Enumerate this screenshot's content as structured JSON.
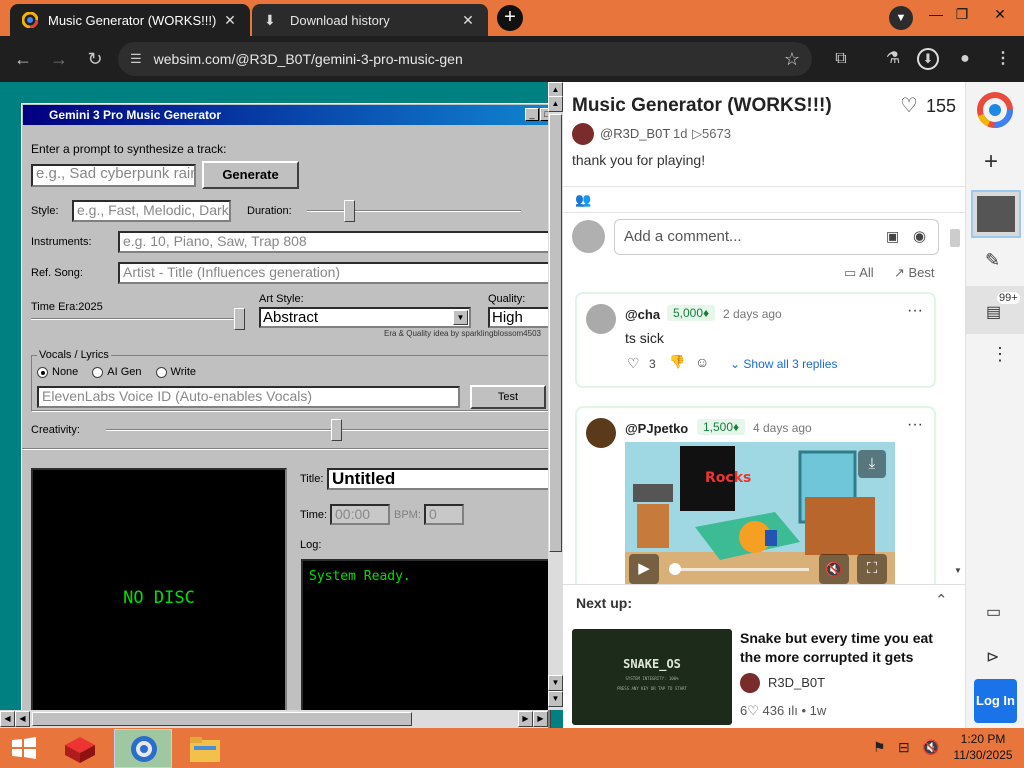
{
  "browser": {
    "tabs": [
      {
        "label": "Music Generator (WORKS!!!)",
        "active": true,
        "close": "✕"
      },
      {
        "label": "Download history",
        "active": false,
        "close": "✕"
      }
    ],
    "new_tab": "+",
    "url": "websim.com/@R3D_B0T/gemini-3-pro-music-gen",
    "window_controls": {
      "minimize": "—",
      "maximize": "❐",
      "close": "✕"
    },
    "colors": {
      "tabbar": "#e8763c",
      "toolbar": "#1f1f1f"
    }
  },
  "app": {
    "title": "Gemini 3 Pro Music Generator",
    "prompt_label": "Enter a prompt to synthesize a track:",
    "prompt_placeholder": "e.g., Sad cyberpunk rain",
    "generate_label": "Generate",
    "style_label": "Style:",
    "style_placeholder": "e.g., Fast, Melodic, Dark",
    "duration_label": "Duration:",
    "duration_level": 0.18,
    "instruments_label": "Instruments:",
    "instruments_placeholder": "e.g. 10, Piano, Saw, Trap 808",
    "refsong_label": "Ref. Song:",
    "refsong_placeholder": "Artist - Title (Influences generation)",
    "time_era_label": "Time Era:2025",
    "time_era_level": 1.0,
    "art_style_label": "Art Style:",
    "art_style_value": "Abstract",
    "quality_label": "Quality:",
    "quality_value": "High",
    "credit": "Era & Quality idea by sparklingblossom4503",
    "vocals_group": "Vocals / Lyrics",
    "vocal_options": [
      {
        "label": "None",
        "selected": true
      },
      {
        "label": "AI Gen",
        "selected": false
      },
      {
        "label": "Write",
        "selected": false
      }
    ],
    "voice_placeholder": "ElevenLabs Voice ID (Auto-enables Vocals)",
    "test_label": "Test",
    "creativity_label": "Creativity:",
    "creativity_level": 0.52,
    "disc_text": "NO DISC",
    "title_label": "Title:",
    "title_value": "Untitled",
    "time_label": "Time:",
    "time_value": "00:00",
    "bpm_label": "BPM:",
    "bpm_value": "0",
    "log_label": "Log:",
    "log_text": "System Ready."
  },
  "panel": {
    "title": "Music Generator (WORKS!!!)",
    "likes": "155",
    "author": "@R3D_B0T",
    "age": "1d",
    "views": "▷5673",
    "description": "thank you for playing!",
    "comment_placeholder": "Add a comment...",
    "filter_all": "All",
    "filter_best": "Best",
    "comments": [
      {
        "user": "@cha",
        "badge": "5,000♦",
        "time": "2 days ago",
        "text": "ts sick",
        "likes": "3",
        "replies": "Show all 3 replies"
      },
      {
        "user": "@PJpetko",
        "badge": "1,500♦",
        "time": "4 days ago",
        "media_sign": "Rocks"
      }
    ],
    "next_up_label": "Next up:",
    "next_title": "Snake but every time you eat the more corrupted it gets",
    "next_thumb_title": "SNAKE_OS",
    "next_thumb_sub1": "SYSTEM INTEGRITY: 100%",
    "next_thumb_sub2": "PRESS ANY KEY OR TAP TO START",
    "next_author": "R3D_B0T",
    "next_stats": "6♡ 436 ılı • 1w"
  },
  "sidebar": {
    "notif_count": "99+",
    "login_label": "Log In",
    "accent": "#1a73e8"
  },
  "taskbar": {
    "time": "1:20 PM",
    "date": "11/30/2025"
  }
}
